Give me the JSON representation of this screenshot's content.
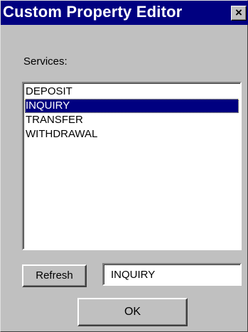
{
  "window": {
    "title": "Custom Property Editor",
    "close_label": "×"
  },
  "services": {
    "label": "Services:",
    "items": [
      "DEPOSIT",
      "INQUIRY",
      "TRANSFER",
      "WITHDRAWAL"
    ],
    "selected": "INQUIRY"
  },
  "controls": {
    "refresh_label": "Refresh",
    "value": "INQUIRY",
    "ok_label": "OK"
  },
  "colors": {
    "titlebar": "#000080",
    "face": "#c0c0c0",
    "selection": "#000080"
  }
}
